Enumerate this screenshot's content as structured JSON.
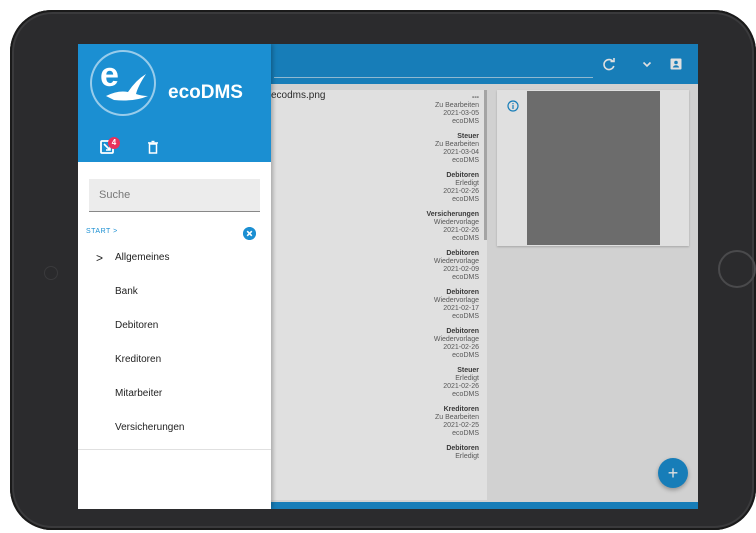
{
  "app": {
    "brand": "ecoDMS",
    "logo_letter": "e"
  },
  "header_icons": {
    "inbox_badge_count": "4"
  },
  "drawer": {
    "search_placeholder": "Suche",
    "breadcrumb": "START >",
    "nav_items": [
      {
        "label": "Allgemeines",
        "has_chevron": true
      },
      {
        "label": "Bank"
      },
      {
        "label": "Debitoren"
      },
      {
        "label": "Kreditoren"
      },
      {
        "label": "Mitarbeiter"
      },
      {
        "label": "Versicherungen"
      }
    ],
    "chevron": ">"
  },
  "documents": {
    "filename": "ecodms.png",
    "entries": [
      {
        "lines": [
          "---",
          "Zu Bearbeiten",
          "2021-03-05",
          "ecoDMS"
        ]
      },
      {
        "lines": [
          "Steuer",
          "Zu Bearbeiten",
          "2021-03-04",
          "ecoDMS"
        ]
      },
      {
        "lines": [
          "Debitoren",
          "Erledigt",
          "2021-02-26",
          "ecoDMS"
        ]
      },
      {
        "lines": [
          "Versicherungen",
          "Wiedervorlage",
          "2021-02-26",
          "ecoDMS"
        ]
      },
      {
        "lines": [
          "Debitoren",
          "Wiedervorlage",
          "2021-02-09",
          "ecoDMS"
        ]
      },
      {
        "lines": [
          "Debitoren",
          "Wiedervorlage",
          "2021-02-17",
          "ecoDMS"
        ]
      },
      {
        "lines": [
          "Debitoren",
          "Wiedervorlage",
          "2021-02-26",
          "ecoDMS"
        ]
      },
      {
        "lines": [
          "Steuer",
          "Erledigt",
          "2021-02-26",
          "ecoDMS"
        ]
      },
      {
        "lines": [
          "Kreditoren",
          "Zu Bearbeiten",
          "2021-02-25",
          "ecoDMS"
        ]
      },
      {
        "lines": [
          "Debitoren",
          "Erledigt"
        ]
      }
    ]
  },
  "fab_label": "+",
  "colors": {
    "primary": "#1b8fd2",
    "badge": "#e8315b"
  }
}
